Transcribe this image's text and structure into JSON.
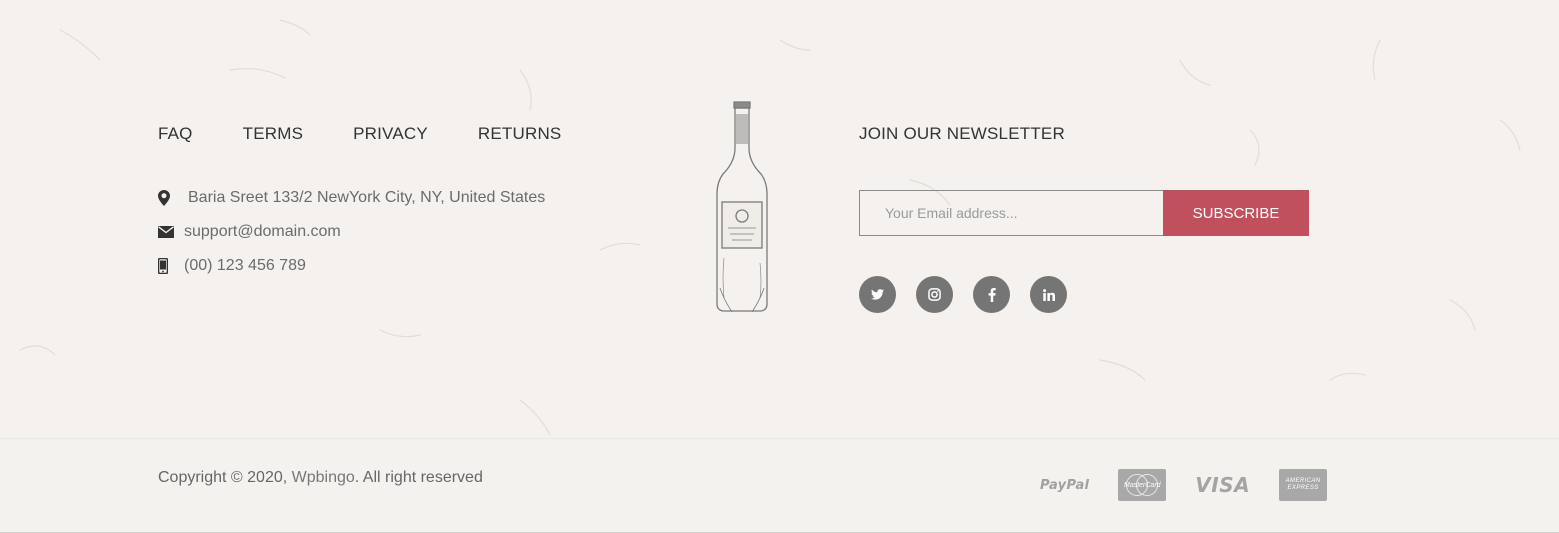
{
  "footer_menu": [
    {
      "label": "FAQ"
    },
    {
      "label": "TERMS"
    },
    {
      "label": "PRIVACY"
    },
    {
      "label": "RETURNS"
    }
  ],
  "contact": {
    "address": "Baria Sreet 133/2 NewYork City, NY, United States",
    "email": "support@domain.com",
    "phone": "(00) 123 456 789"
  },
  "newsletter": {
    "title": "JOIN OUR NEWSLETTER",
    "placeholder": "Your Email address...",
    "button_label": "SUBSCRIBE"
  },
  "social": [
    "twitter-icon",
    "instagram-icon",
    "facebook-icon",
    "linkedin-icon"
  ],
  "copyright": {
    "prefix": "Copyright © 2020, ",
    "brand": "Wpbingo",
    "suffix": ". All right reserved"
  },
  "payments": {
    "paypal": "PayPal",
    "mastercard": "MasterCard",
    "visa": "VISA",
    "amex_line1": "AMERICAN",
    "amex_line2": "EXPRESS"
  },
  "colors": {
    "accent": "#c0505e",
    "social_bg": "#757575",
    "background": "#f4f1ee"
  }
}
